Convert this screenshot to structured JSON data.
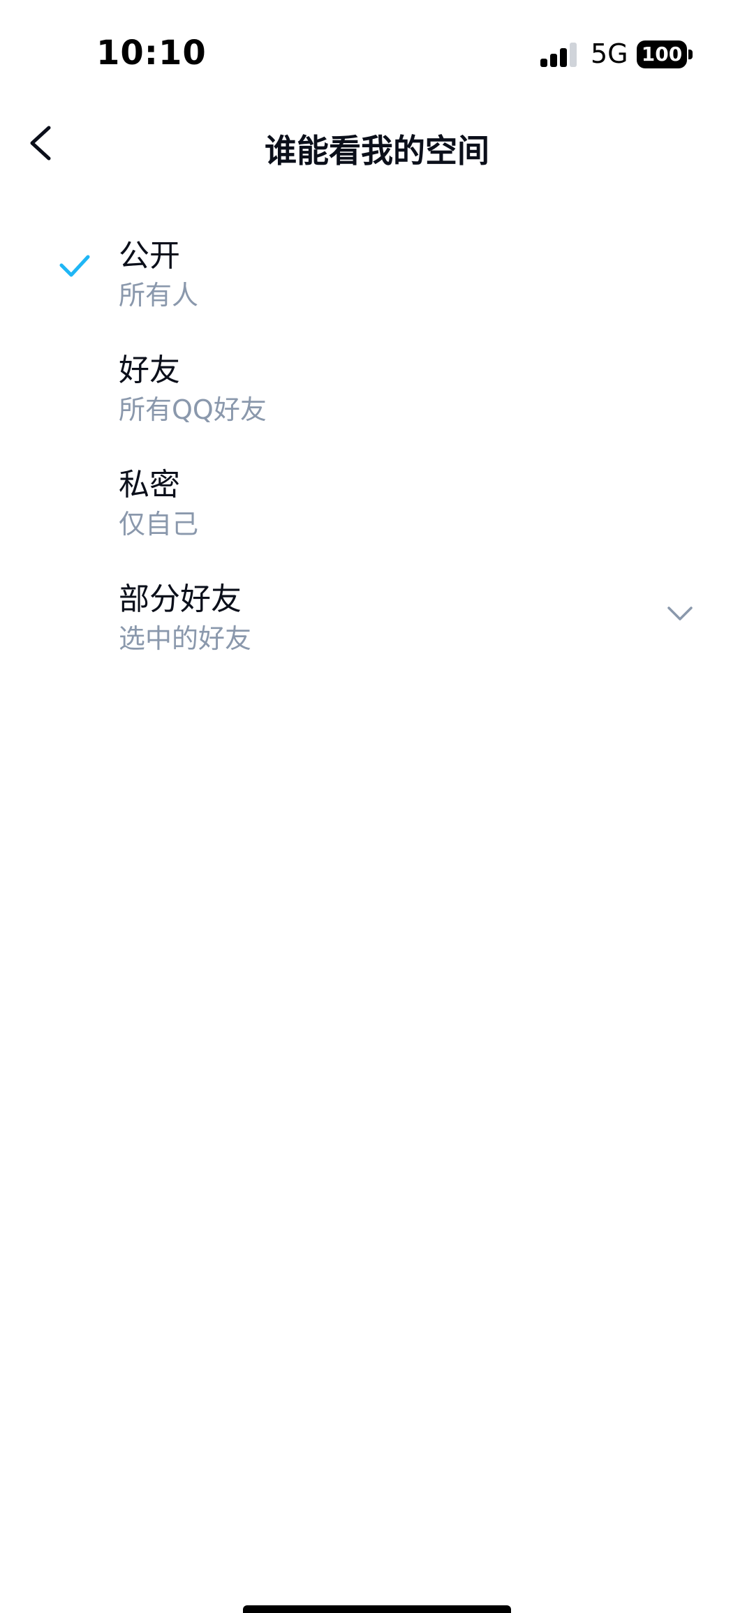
{
  "status_bar": {
    "time": "10:10",
    "network": "5G",
    "battery": "100"
  },
  "nav": {
    "title": "谁能看我的空间",
    "back_icon": "chevron-left-icon"
  },
  "options": [
    {
      "label": "公开",
      "sublabel": "所有人",
      "selected": true
    },
    {
      "label": "好友",
      "sublabel": "所有QQ好友",
      "selected": false
    },
    {
      "label": "私密",
      "sublabel": "仅自己",
      "selected": false
    },
    {
      "label": "部分好友",
      "sublabel": "选中的好友",
      "selected": false,
      "expandable": true
    }
  ],
  "colors": {
    "accent": "#1fb6f5",
    "text_primary": "#0b0f1a",
    "text_secondary": "#8a98ac",
    "chevron": "#8a98ac",
    "background": "#ffffff"
  }
}
